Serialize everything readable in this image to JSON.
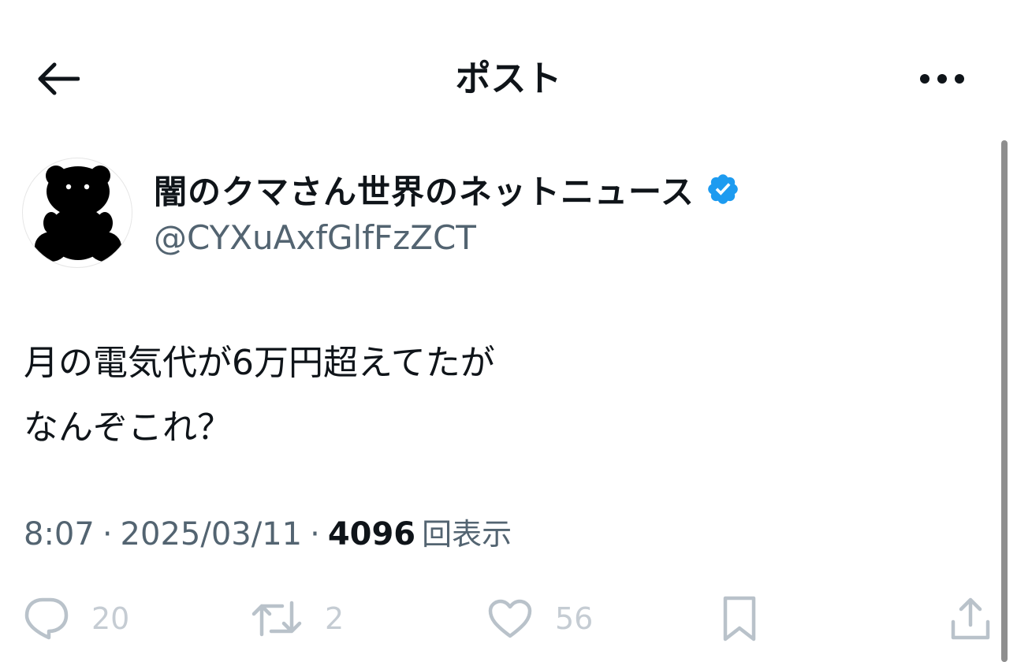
{
  "header": {
    "title": "ポスト",
    "back_icon": "arrow-left-icon",
    "more_icon": "more-horizontal-icon"
  },
  "author": {
    "display_name": "闇のクマさん世界のネットニュース",
    "handle": "@CYXuAxfGlfFzZCT",
    "verified": true,
    "avatar_icon": "bear-silhouette-icon"
  },
  "post": {
    "lines": [
      "月の電気代が6万円超えてたが",
      "なんぞこれ？"
    ]
  },
  "meta": {
    "time": "8:07",
    "separator": "·",
    "date": "2025/03/11",
    "views_count": "4096",
    "views_label": "回表示"
  },
  "actions": {
    "replies": "20",
    "reposts": "2",
    "likes": "56"
  },
  "colors": {
    "text": "#0f1419",
    "secondary": "#536471",
    "verified_blue": "#1d9bf0",
    "action_gray": "#b9c2ca"
  }
}
